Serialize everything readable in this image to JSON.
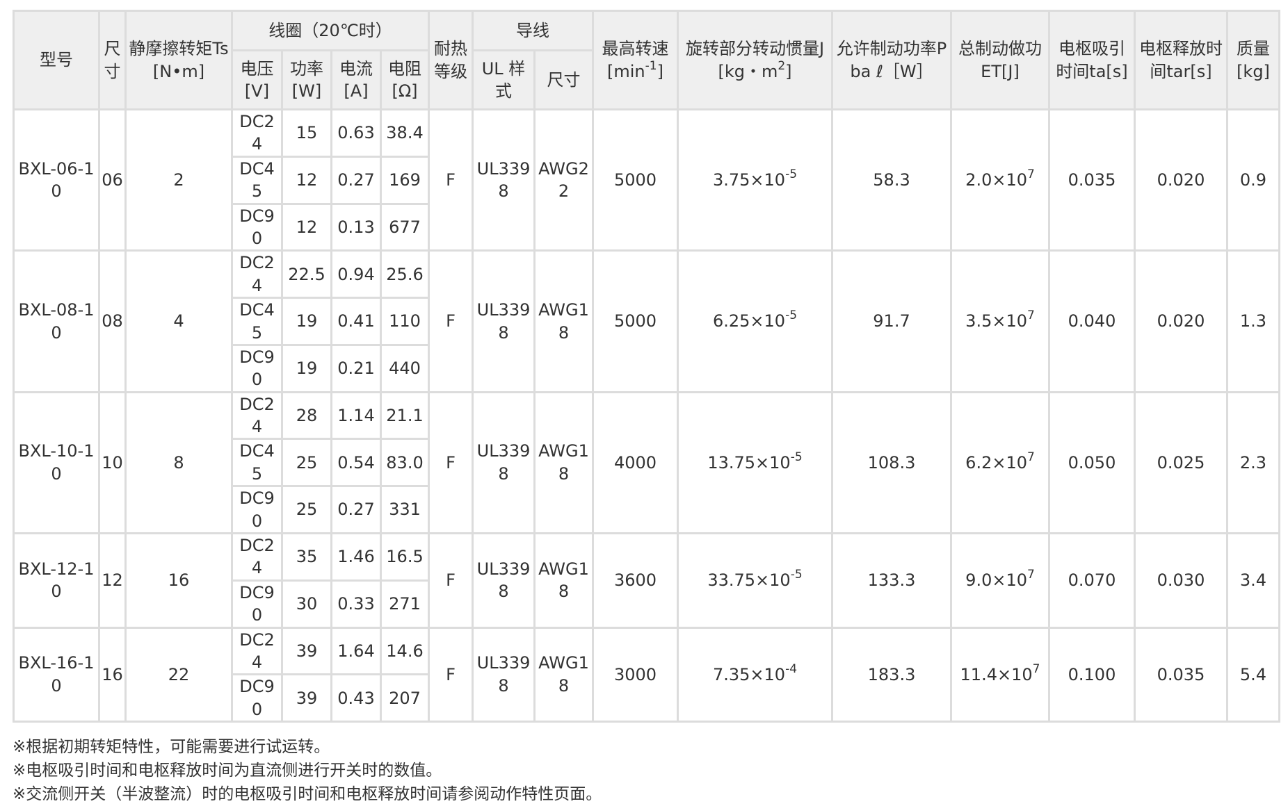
{
  "headers": {
    "model": "型号",
    "size": "尺寸",
    "torque": "静摩擦转矩Ts[N•m]",
    "coil_group": "线圈（20℃时）",
    "voltage": "电压[V]",
    "power": "功率[W]",
    "current": "电流[A]",
    "resistance": "电阻[Ω]",
    "heat_class": "耐热等级",
    "lead_group": "导线",
    "ul_style": "UL 样式",
    "lead_size": "尺寸",
    "max_speed": "最高转速[min",
    "max_speed_exp": "-1",
    "max_speed_close": "]",
    "inertia_title": "旋转部分转动惯量J",
    "inertia_unit": "[kg・m",
    "inertia_unit_exp": "2",
    "inertia_unit_close": "]",
    "brake_power": "允许制动功率Pba ℓ［W］",
    "brake_work": "总制动做功ET[J]",
    "attract_time": "电枢吸引时间ta[s]",
    "release_time": "电枢释放时间tar[s]",
    "mass": "质量[kg]"
  },
  "rows": [
    {
      "model": "BXL-06-10",
      "size": "06",
      "torque": "2",
      "coils": [
        {
          "voltage": "DC24",
          "power": "15",
          "current": "0.63",
          "resistance": "38.4"
        },
        {
          "voltage": "DC45",
          "power": "12",
          "current": "0.27",
          "resistance": "169"
        },
        {
          "voltage": "DC90",
          "power": "12",
          "current": "0.13",
          "resistance": "677"
        }
      ],
      "heat_class": "F",
      "ul_style": "UL3398",
      "lead_size": "AWG22",
      "max_speed": "5000",
      "inertia_mantissa": "3.75×10",
      "inertia_exp": "-5",
      "brake_power": "58.3",
      "brake_work_mantissa": "2.0×10",
      "brake_work_exp": "7",
      "attract_time": "0.035",
      "release_time": "0.020",
      "mass": "0.9"
    },
    {
      "model": "BXL-08-10",
      "size": "08",
      "torque": "4",
      "coils": [
        {
          "voltage": "DC24",
          "power": "22.5",
          "current": "0.94",
          "resistance": "25.6"
        },
        {
          "voltage": "DC45",
          "power": "19",
          "current": "0.41",
          "resistance": "110"
        },
        {
          "voltage": "DC90",
          "power": "19",
          "current": "0.21",
          "resistance": "440"
        }
      ],
      "heat_class": "F",
      "ul_style": "UL3398",
      "lead_size": "AWG18",
      "max_speed": "5000",
      "inertia_mantissa": "6.25×10",
      "inertia_exp": "-5",
      "brake_power": "91.7",
      "brake_work_mantissa": "3.5×10",
      "brake_work_exp": "7",
      "attract_time": "0.040",
      "release_time": "0.020",
      "mass": "1.3"
    },
    {
      "model": "BXL-10-10",
      "size": "10",
      "torque": "8",
      "coils": [
        {
          "voltage": "DC24",
          "power": "28",
          "current": "1.14",
          "resistance": "21.1"
        },
        {
          "voltage": "DC45",
          "power": "25",
          "current": "0.54",
          "resistance": "83.0"
        },
        {
          "voltage": "DC90",
          "power": "25",
          "current": "0.27",
          "resistance": "331"
        }
      ],
      "heat_class": "F",
      "ul_style": "UL3398",
      "lead_size": "AWG18",
      "max_speed": "4000",
      "inertia_mantissa": "13.75×10",
      "inertia_exp": "-5",
      "brake_power": "108.3",
      "brake_work_mantissa": "6.2×10",
      "brake_work_exp": "7",
      "attract_time": "0.050",
      "release_time": "0.025",
      "mass": "2.3"
    },
    {
      "model": "BXL-12-10",
      "size": "12",
      "torque": "16",
      "coils": [
        {
          "voltage": "DC24",
          "power": "35",
          "current": "1.46",
          "resistance": "16.5"
        },
        {
          "voltage": "DC90",
          "power": "30",
          "current": "0.33",
          "resistance": "271"
        }
      ],
      "heat_class": "F",
      "ul_style": "UL3398",
      "lead_size": "AWG18",
      "max_speed": "3600",
      "inertia_mantissa": "33.75×10",
      "inertia_exp": "-5",
      "brake_power": "133.3",
      "brake_work_mantissa": "9.0×10",
      "brake_work_exp": "7",
      "attract_time": "0.070",
      "release_time": "0.030",
      "mass": "3.4"
    },
    {
      "model": "BXL-16-10",
      "size": "16",
      "torque": "22",
      "coils": [
        {
          "voltage": "DC24",
          "power": "39",
          "current": "1.64",
          "resistance": "14.6"
        },
        {
          "voltage": "DC90",
          "power": "39",
          "current": "0.43",
          "resistance": "207"
        }
      ],
      "heat_class": "F",
      "ul_style": "UL3398",
      "lead_size": "AWG18",
      "max_speed": "3000",
      "inertia_mantissa": "7.35×10",
      "inertia_exp": "-4",
      "brake_power": "183.3",
      "brake_work_mantissa": "11.4×10",
      "brake_work_exp": "7",
      "attract_time": "0.100",
      "release_time": "0.035",
      "mass": "5.4"
    }
  ],
  "notes": [
    "※根据初期转矩特性，可能需要进行试运转。",
    "※电枢吸引时间和电枢释放时间为直流侧进行开关时的数值。",
    "※交流侧开关（半波整流）时的电枢吸引时间和电枢释放时间请参阅动作特性页面。"
  ]
}
